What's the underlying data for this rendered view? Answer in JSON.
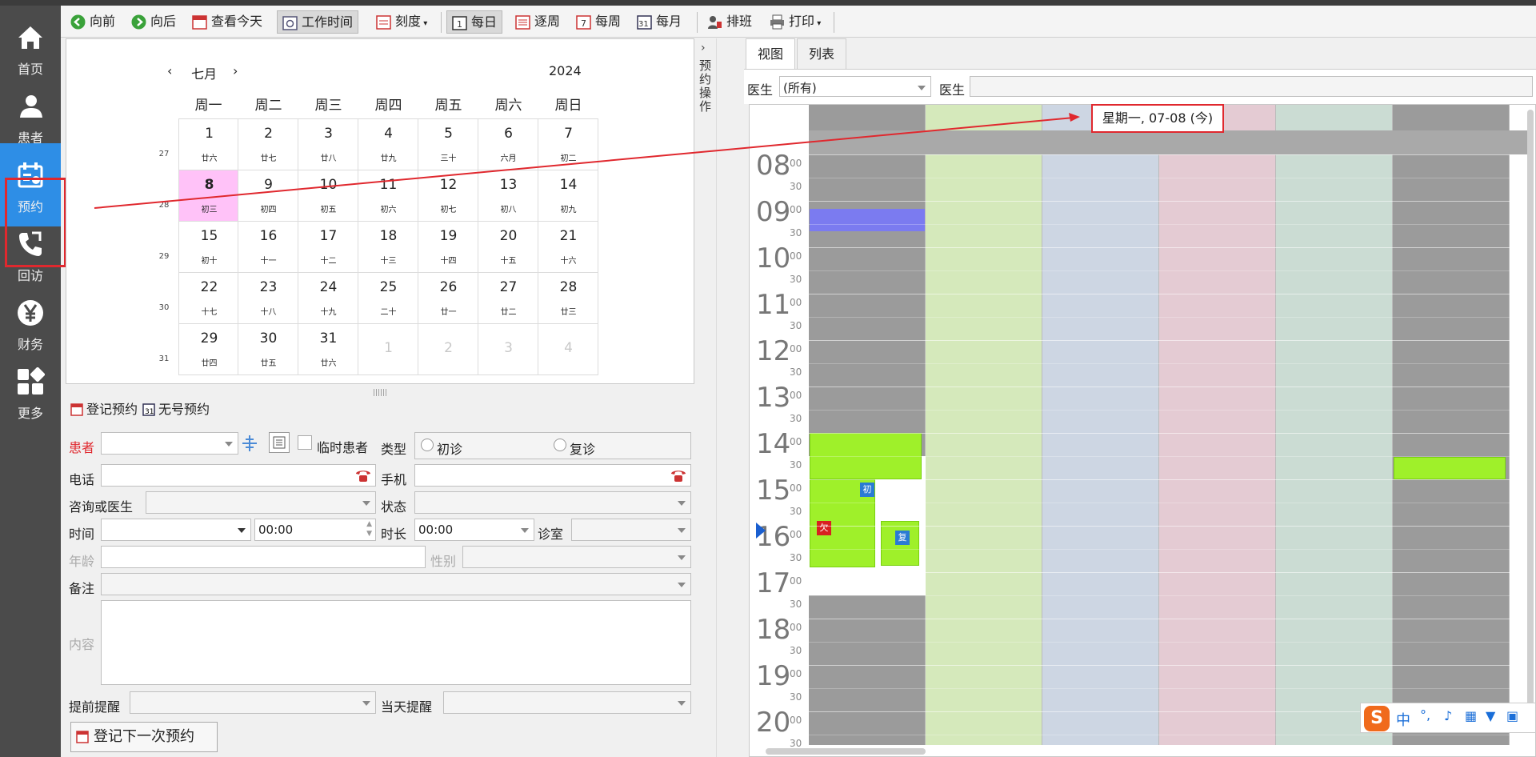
{
  "nav": {
    "items": [
      {
        "label": "首页",
        "icon": "home-icon"
      },
      {
        "label": "患者",
        "icon": "patient-icon"
      },
      {
        "label": "预约",
        "icon": "appointment-icon"
      },
      {
        "label": "回访",
        "icon": "phone-callback-icon"
      },
      {
        "label": "财务",
        "icon": "yen-icon"
      },
      {
        "label": "更多",
        "icon": "grid-icon"
      }
    ]
  },
  "toolbar": {
    "prev": "向前",
    "next": "向后",
    "today": "查看今天",
    "worktime": "工作时间",
    "scale": "刻度",
    "day": "每日",
    "byweek": "逐周",
    "week": "每周",
    "month": "每月",
    "shift": "排班",
    "print": "打印"
  },
  "calendar": {
    "month": "七月",
    "year": "2024",
    "prev_label": "‹",
    "next_label": "›",
    "weekdays": [
      "周一",
      "周二",
      "周三",
      "周四",
      "周五",
      "周六",
      "周日"
    ],
    "weeknums": [
      "27",
      "28",
      "29",
      "30",
      "31"
    ],
    "weeks": [
      [
        {
          "d": "1",
          "l": "廿六"
        },
        {
          "d": "2",
          "l": "廿七"
        },
        {
          "d": "3",
          "l": "廿八"
        },
        {
          "d": "4",
          "l": "廿九"
        },
        {
          "d": "5",
          "l": "三十"
        },
        {
          "d": "6",
          "l": "六月"
        },
        {
          "d": "7",
          "l": "初二"
        }
      ],
      [
        {
          "d": "8",
          "l": "初三",
          "today": true
        },
        {
          "d": "9",
          "l": "初四"
        },
        {
          "d": "10",
          "l": "初五"
        },
        {
          "d": "11",
          "l": "初六"
        },
        {
          "d": "12",
          "l": "初七"
        },
        {
          "d": "13",
          "l": "初八"
        },
        {
          "d": "14",
          "l": "初九"
        }
      ],
      [
        {
          "d": "15",
          "l": "初十"
        },
        {
          "d": "16",
          "l": "十一"
        },
        {
          "d": "17",
          "l": "十二"
        },
        {
          "d": "18",
          "l": "十三"
        },
        {
          "d": "19",
          "l": "十四"
        },
        {
          "d": "20",
          "l": "十五"
        },
        {
          "d": "21",
          "l": "十六"
        }
      ],
      [
        {
          "d": "22",
          "l": "十七"
        },
        {
          "d": "23",
          "l": "十八"
        },
        {
          "d": "24",
          "l": "十九"
        },
        {
          "d": "25",
          "l": "二十"
        },
        {
          "d": "26",
          "l": "廿一"
        },
        {
          "d": "27",
          "l": "廿二"
        },
        {
          "d": "28",
          "l": "廿三"
        }
      ],
      [
        {
          "d": "29",
          "l": "廿四"
        },
        {
          "d": "30",
          "l": "廿五"
        },
        {
          "d": "31",
          "l": "廿六"
        },
        {
          "d": "1",
          "l": "",
          "dim": true
        },
        {
          "d": "2",
          "l": "",
          "dim": true
        },
        {
          "d": "3",
          "l": "",
          "dim": true
        },
        {
          "d": "4",
          "l": "",
          "dim": true
        }
      ]
    ]
  },
  "form": {
    "tab_register": "登记预约",
    "tab_nonum": "无号预约",
    "patient": "患者",
    "temp_patient": "临时患者",
    "type": "类型",
    "first_visit": "初诊",
    "revisit": "复诊",
    "phone": "电话",
    "mobile": "手机",
    "consult_doctor": "咨询或医生",
    "status": "状态",
    "time": "时间",
    "time_value": "00:00",
    "duration": "时长",
    "duration_value": "00:00",
    "room": "诊室",
    "age": "年龄",
    "gender": "性别",
    "remark": "备注",
    "content": "内容",
    "remind_before": "提前提醒",
    "remind_day": "当天提醒",
    "next_button": "登记下一次预约"
  },
  "side_label": "预约操作",
  "right": {
    "tab_view": "视图",
    "tab_list": "列表",
    "doctor_label": "医生",
    "doctor_value": "(所有)",
    "doctor_label2": "医生",
    "day_label": "星期一, 07-08 (今)"
  },
  "schedule": {
    "hours": [
      "08",
      "09",
      "10",
      "11",
      "12",
      "13",
      "14",
      "15",
      "16",
      "17",
      "18",
      "19",
      "20"
    ],
    "min00": "00",
    "min30": "30",
    "tags": [
      "初",
      "复",
      "欠"
    ]
  },
  "ime": {
    "text": "中"
  }
}
